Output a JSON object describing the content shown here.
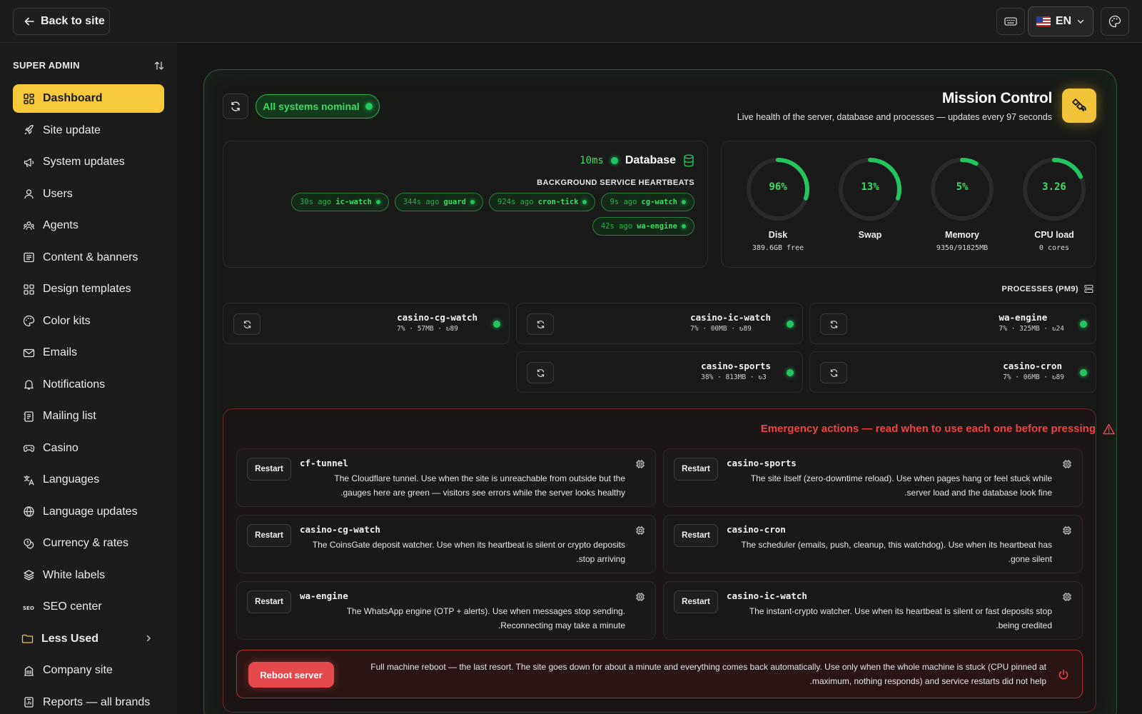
{
  "topbar": {
    "back_label": "Back to site",
    "language": "EN",
    "icons": [
      "arrow-left-icon",
      "keyboard-icon",
      "us-flag-icon",
      "chevron-down-icon",
      "palette-icon"
    ]
  },
  "sidebar": {
    "header": "SUPER ADMIN",
    "items": [
      {
        "label": "Dashboard",
        "icon": "dashboard-icon",
        "active": true
      },
      {
        "label": "Site update",
        "icon": "rocket-icon"
      },
      {
        "label": "System updates",
        "icon": "megaphone-icon"
      },
      {
        "label": "Users",
        "icon": "user-icon"
      },
      {
        "label": "Agents",
        "icon": "agents-icon"
      },
      {
        "label": "Content & banners",
        "icon": "content-icon"
      },
      {
        "label": "Design templates",
        "icon": "grid-icon"
      },
      {
        "label": "Color kits",
        "icon": "palette-icon"
      },
      {
        "label": "Emails",
        "icon": "mail-icon"
      },
      {
        "label": "Notifications",
        "icon": "bell-icon"
      },
      {
        "label": "Mailing list",
        "icon": "list-icon"
      },
      {
        "label": "Casino",
        "icon": "gamepad-icon"
      },
      {
        "label": "Languages",
        "icon": "languages-icon"
      },
      {
        "label": "Language updates",
        "icon": "globe-icon"
      },
      {
        "label": "Currency & rates",
        "icon": "coins-icon"
      },
      {
        "label": "White labels",
        "icon": "layers-icon"
      },
      {
        "label": "SEO center",
        "icon": "seo-icon"
      },
      {
        "label": "Less Used",
        "icon": "folder-icon"
      },
      {
        "label": "Company site",
        "icon": "building-icon"
      },
      {
        "label": "Reports — all brands",
        "icon": "report-icon"
      }
    ]
  },
  "header": {
    "status": "All systems nominal",
    "title": "Mission Control",
    "subtitle": "Live health of the server, database and processes — updates every 97 seconds"
  },
  "database": {
    "latency": "10ms",
    "label": "Database",
    "heartbeats_title": "BACKGROUND SERVICE HEARTBEATS",
    "heartbeats": [
      {
        "ago": "30s ago",
        "name": "ic-watch"
      },
      {
        "ago": "344s ago",
        "name": "guard"
      },
      {
        "ago": "924s ago",
        "name": "cron-tick"
      },
      {
        "ago": "9s ago",
        "name": "cg-watch"
      },
      {
        "ago": "42s ago",
        "name": "wa-engine"
      }
    ]
  },
  "gauges": [
    {
      "value": "96%",
      "label": "Disk",
      "sub": "389.6GB free",
      "fraction": 0.3
    },
    {
      "value": "13%",
      "label": "Swap",
      "sub": "",
      "fraction": 0.3
    },
    {
      "value": "5%",
      "label": "Memory",
      "sub": "9350/91825MB",
      "fraction": 0.08
    },
    {
      "value": "3.26",
      "label": "CPU load",
      "sub": "0 cores",
      "fraction": 0.18
    }
  ],
  "processes": {
    "title": "PROCESSES (PM9)",
    "items": [
      {
        "name": "casino-cg-watch",
        "meta": "7% · 57MB · ↻89"
      },
      {
        "name": "casino-ic-watch",
        "meta": "7% · 00MB · ↻89"
      },
      {
        "name": "wa-engine",
        "meta": "7% · 325MB · ↻24"
      },
      {
        "name": "casino-sports",
        "meta": "38% · 813MB · ↻3"
      },
      {
        "name": "casino-cron",
        "meta": "7% · 06MB · ↻89"
      }
    ]
  },
  "emergency": {
    "title": "Emergency actions — read when to use each one before pressing",
    "restart_label": "Restart",
    "actions": [
      {
        "name": "cf-tunnel",
        "desc": "The Cloudflare tunnel. Use when the site is unreachable from outside but the .gauges here are green — visitors see errors while the server looks healthy"
      },
      {
        "name": "casino-sports",
        "desc": "The site itself (zero-downtime reload). Use when pages hang or feel stuck while .server load and the database look fine"
      },
      {
        "name": "casino-cg-watch",
        "desc": "The CoinsGate deposit watcher. Use when its heartbeat is silent or crypto deposits .stop arriving"
      },
      {
        "name": "casino-cron",
        "desc": "The scheduler (emails, push, cleanup, this watchdog). Use when its heartbeat has .gone silent"
      },
      {
        "name": "wa-engine",
        "desc": "The WhatsApp engine (OTP + alerts). Use when messages stop sending. .Reconnecting may take a minute"
      },
      {
        "name": "casino-ic-watch",
        "desc": "The instant-crypto watcher. Use when its heartbeat is silent or fast deposits stop .being credited"
      }
    ],
    "reboot_label": "Reboot server",
    "reboot_desc": "Full machine reboot — the last resort. The site goes down for about a minute and everything comes back automatically. Use only when the whole machine is stuck (CPU pinned at .maximum, nothing responds) and service restarts did not help"
  },
  "colors": {
    "accent": "#f8c93a",
    "ok": "#22c55e",
    "danger": "#ef4444"
  }
}
